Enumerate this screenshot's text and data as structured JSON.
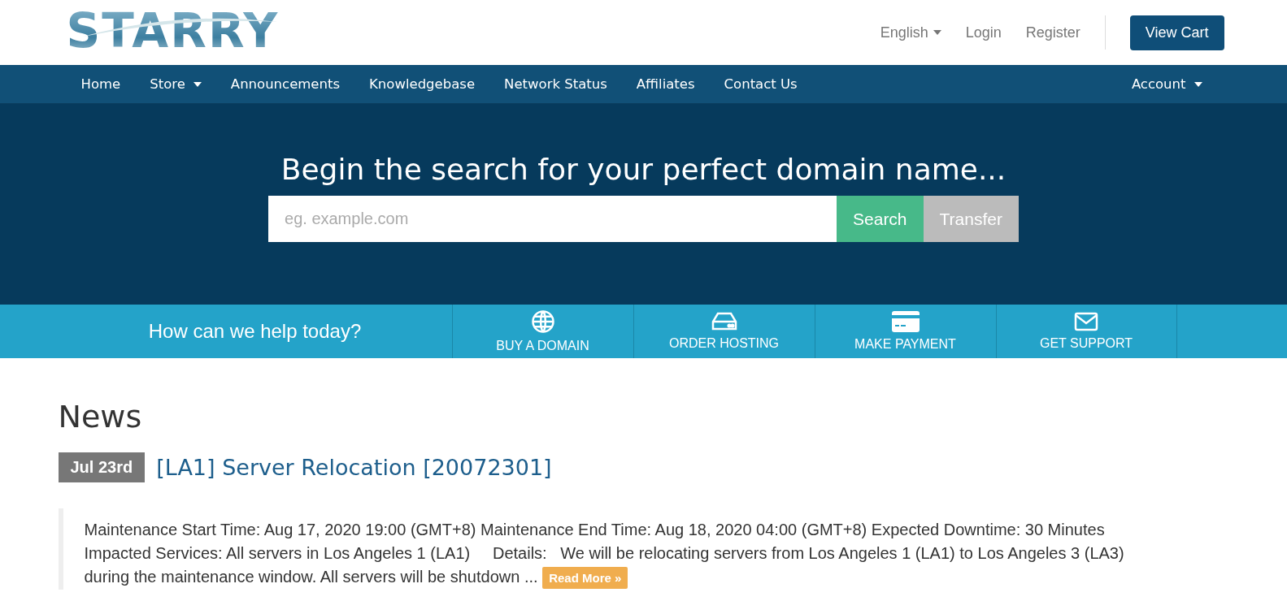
{
  "logo": {
    "text": "STARRY"
  },
  "top_links": [
    {
      "label": "English",
      "dropdown": true
    },
    {
      "label": "Login",
      "dropdown": false
    },
    {
      "label": "Register",
      "dropdown": false
    }
  ],
  "cart_button": "View Cart",
  "nav": {
    "items": [
      {
        "label": "Home",
        "dropdown": false
      },
      {
        "label": "Store",
        "dropdown": true
      },
      {
        "label": "Announcements",
        "dropdown": false
      },
      {
        "label": "Knowledgebase",
        "dropdown": false
      },
      {
        "label": "Network Status",
        "dropdown": false
      },
      {
        "label": "Affiliates",
        "dropdown": false
      },
      {
        "label": "Contact Us",
        "dropdown": false
      }
    ],
    "right": [
      {
        "label": "Account",
        "dropdown": true
      }
    ]
  },
  "hero": {
    "title": "Begin the search for your perfect domain name...",
    "search": {
      "placeholder": "eg. example.com"
    },
    "buttons": [
      {
        "label": "Search",
        "kind": "primary"
      },
      {
        "label": "Transfer",
        "kind": "secondary"
      }
    ]
  },
  "help_bar": {
    "title": "How can we help today?",
    "actions": [
      {
        "label": "BUY A DOMAIN",
        "kind": "globe"
      },
      {
        "label": "ORDER HOSTING",
        "kind": "server"
      },
      {
        "label": "MAKE PAYMENT",
        "kind": "card"
      },
      {
        "label": "GET SUPPORT",
        "kind": "mail"
      }
    ]
  },
  "news": {
    "heading": "News",
    "items": [
      {
        "date": "Jul 23rd",
        "title": "[LA1] Server Relocation [20072301]",
        "summary": "Maintenance Start Time: Aug 17, 2020 19:00 (GMT+8) Maintenance End Time: Aug 18, 2020 04:00 (GMT+8) Expected Downtime: 30 Minutes Impacted Services: All servers in Los Angeles 1 (LA1)     Details:   We will be relocating servers from Los Angeles 1 (LA1) to Los Angeles 3 (LA3) during the maintenance window. All servers will be shutdown ...",
        "read_more": "Read More »"
      }
    ]
  }
}
